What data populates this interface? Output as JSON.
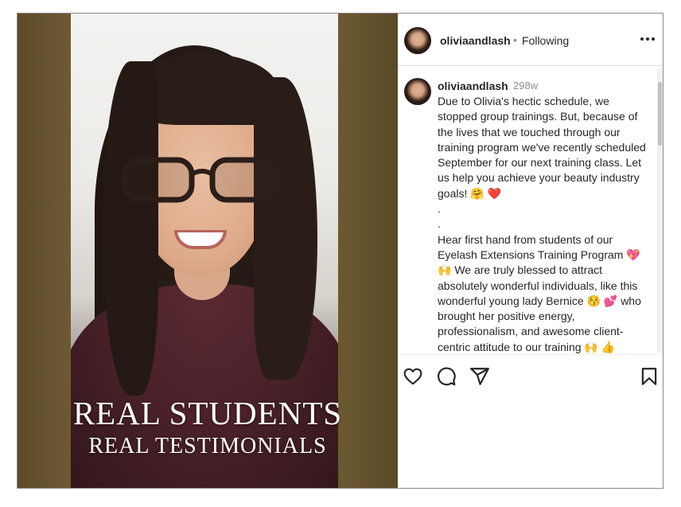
{
  "video": {
    "overlay_line1": "REAL STUDENTS",
    "overlay_line2": "REAL TESTIMONIALS",
    "background_color": "#7b6639"
  },
  "header": {
    "username": "oliviaandlash",
    "separator": "•",
    "follow_status": "Following",
    "more_icon": "more-horizontal-icon"
  },
  "post": {
    "username": "oliviaandlash",
    "age": "298w",
    "caption": "Due to Olivia's hectic schedule, we stopped group trainings. But, because of the lives that we touched through our training program we've recently scheduled September for our next training class. Let us help you achieve your beauty industry goals! 🤗 ❤️\n.\n.\nHear first hand from students of our Eyelash Extensions Training Program 💖 🙌 We are truly blessed to attract absolutely wonderful individuals, like this wonderful young lady Bernice 😚 💕 who brought her positive energy, professionalism, and awesome client-centric attitude to our training 🙌 👍"
  },
  "actions": {
    "like_icon": "heart-icon",
    "comment_icon": "comment-icon",
    "share_icon": "send-icon",
    "save_icon": "bookmark-icon"
  }
}
